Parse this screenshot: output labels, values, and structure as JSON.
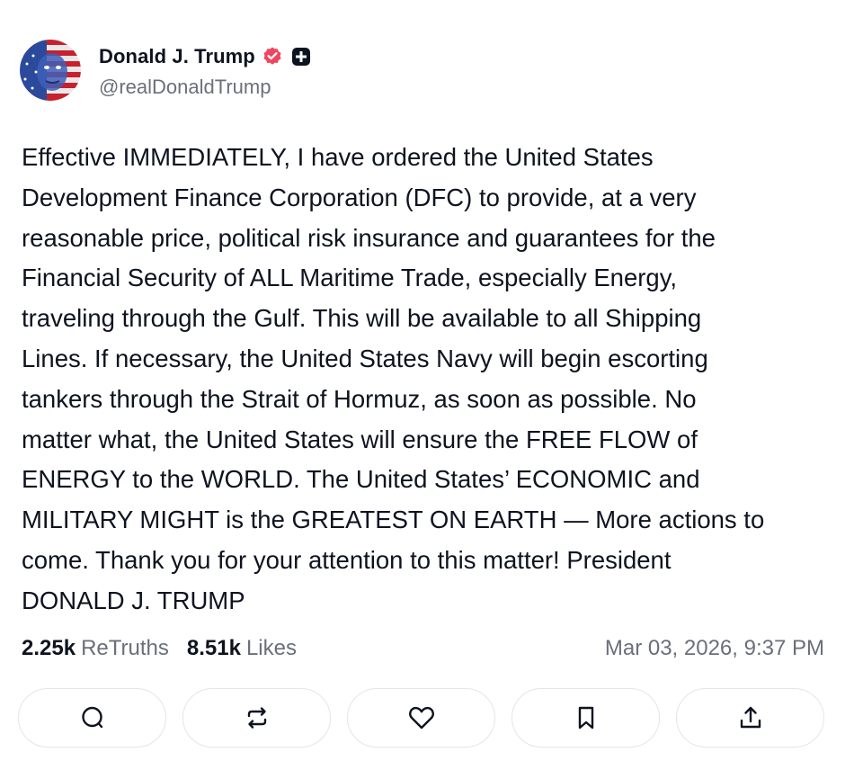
{
  "author": {
    "display_name": "Donald J. Trump",
    "handle": "@realDonaldTrump",
    "verified_badge_icon": "verified-badge-icon",
    "plus_badge_icon": "plus-badge-icon",
    "verified_color": "#f1455f"
  },
  "post": {
    "text": "Effective IMMEDIATELY, I have ordered the United States\nDevelopment Finance Corporation (DFC) to provide, at a very\nreasonable price, political risk insurance and guarantees for the\nFinancial Security of ALL Maritime Trade, especially Energy,\ntraveling through the Gulf. This will be available to all Shipping\nLines. If necessary, the United States Navy will begin escorting\ntankers through the Strait of Hormuz, as soon as possible. No\nmatter what, the United States will ensure the FREE FLOW of\nENERGY to the WORLD. The United States’ ECONOMIC and\nMILITARY MIGHT is the GREATEST ON EARTH — More actions to\ncome. Thank you for your attention to this matter! President\nDONALD J. TRUMP"
  },
  "stats": {
    "retruths_count": "2.25k",
    "retruths_label": "ReTruths",
    "likes_count": "8.51k",
    "likes_label": "Likes"
  },
  "timestamp": "Mar 03, 2026, 9:37 PM",
  "actions": [
    {
      "icon": "reply-icon"
    },
    {
      "icon": "retruth-icon"
    },
    {
      "icon": "like-icon"
    },
    {
      "icon": "bookmark-icon"
    },
    {
      "icon": "share-icon"
    }
  ],
  "colors": {
    "text_primary": "#0e1320",
    "text_secondary": "#6b6f7b",
    "button_border": "#e4e5e9"
  }
}
